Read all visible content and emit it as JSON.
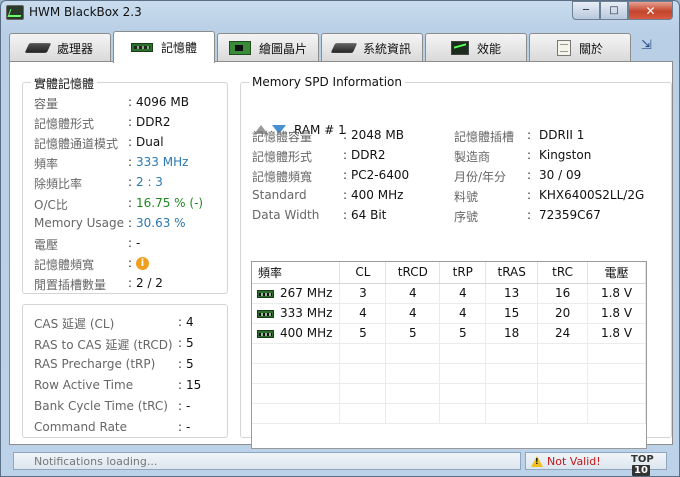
{
  "window": {
    "title": "HWM BlackBox 2.3",
    "controls": {
      "minimize": "─",
      "maximize": "□",
      "close": "✕"
    }
  },
  "tabs": [
    {
      "label": "處理器",
      "icon": "cpu-chip-icon"
    },
    {
      "label": "記憶體",
      "icon": "ram-module-icon",
      "active": true
    },
    {
      "label": "繪圖晶片",
      "icon": "graphics-card-icon"
    },
    {
      "label": "系統資訊",
      "icon": "system-chip-icon"
    },
    {
      "label": "效能",
      "icon": "performance-monitor-icon"
    },
    {
      "label": "關於",
      "icon": "about-document-icon"
    }
  ],
  "physical_memory": {
    "title": "實體記憶體",
    "rows": [
      {
        "label": "容量",
        "value": "4096 MB"
      },
      {
        "label": "記憶體形式",
        "value": "DDR2"
      },
      {
        "label": "記憶體通道模式",
        "value": "Dual"
      },
      {
        "label": "頻率",
        "value": "333 MHz",
        "color": "blue"
      },
      {
        "label": "除頻比率",
        "value": "2 : 3",
        "color": "blue"
      },
      {
        "label": "O/C比",
        "value": "16.75 % (-)",
        "color": "green"
      },
      {
        "label": "Memory Usage",
        "value": "30.63 %",
        "color": "blue"
      },
      {
        "label": "電壓",
        "value": "-"
      },
      {
        "label": "記憶體頻寬",
        "value": ""
      },
      {
        "label": "閒置插槽數量",
        "value": "2 / 2"
      }
    ]
  },
  "timings": {
    "rows": [
      {
        "label": "CAS 延遲 (CL)",
        "value": "4"
      },
      {
        "label": "RAS to CAS 延遲 (tRCD)",
        "value": "5"
      },
      {
        "label": "RAS Precharge (tRP)",
        "value": "5"
      },
      {
        "label": "Row Active Time",
        "value": "15"
      },
      {
        "label": "Bank Cycle Time (tRC)",
        "value": "-"
      },
      {
        "label": "Command Rate",
        "value": "-"
      }
    ]
  },
  "spd": {
    "title": "Memory SPD Information",
    "ram_label": "RAM # 1",
    "left_rows": [
      {
        "label": "記憶體容量",
        "value": "2048 MB"
      },
      {
        "label": "記憶體形式",
        "value": "DDR2"
      },
      {
        "label": "記憶體頻寬",
        "value": "PC2-6400"
      },
      {
        "label": "Standard",
        "value": "400 MHz"
      },
      {
        "label": "Data Width",
        "value": "64 Bit"
      }
    ],
    "right_rows": [
      {
        "label": "記憶體插槽",
        "value": "DDRII 1"
      },
      {
        "label": "製造商",
        "value": "Kingston"
      },
      {
        "label": "月份/年分",
        "value": "30 / 09"
      },
      {
        "label": "料號",
        "value": "KHX6400S2LL/2G"
      },
      {
        "label": "序號",
        "value": "72359C67"
      }
    ],
    "table": {
      "columns": [
        "頻率",
        "CL",
        "tRCD",
        "tRP",
        "tRAS",
        "tRC",
        "電壓"
      ],
      "rows": [
        [
          "267 MHz",
          "3",
          "4",
          "4",
          "13",
          "16",
          "1.8 V"
        ],
        [
          "333 MHz",
          "4",
          "4",
          "4",
          "15",
          "20",
          "1.8 V"
        ],
        [
          "400 MHz",
          "5",
          "5",
          "5",
          "18",
          "24",
          "1.8 V"
        ]
      ]
    }
  },
  "status": {
    "notifications": "Notifications loading...",
    "validation": "Not Valid!",
    "top_badge_text": "TOP",
    "top_badge_num": "10"
  }
}
